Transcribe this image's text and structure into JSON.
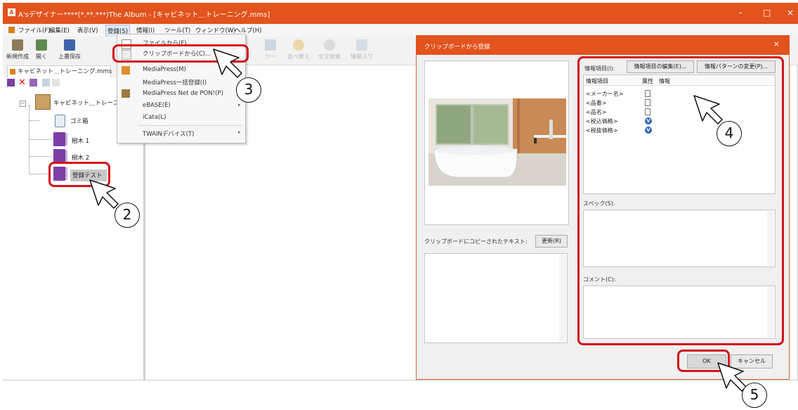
{
  "window": {
    "title": "A'sデザイナー****(*.**.***)The Album - [キャビネット＿トレーニング.mms]",
    "controls": [
      "-",
      "□",
      "×"
    ]
  },
  "menubar": {
    "items": [
      "ファイル(F)",
      "編集(E)",
      "表示(V)",
      "登録(S)",
      "情報(I)",
      "ツール(T)",
      "ウィンドウ(W)",
      "ヘルプ(H)"
    ]
  },
  "toolbar": {
    "new_label": "新規作成",
    "open_label": "開く",
    "overwrite_label": "上書保存",
    "faded": [
      "ツー",
      "並べ替え",
      "全文検索",
      "情報スワ"
    ]
  },
  "left_panel": {
    "tab_label": "キャビネット＿トレーニング.mms",
    "root_label": "キャビネット＿トレーニング",
    "items": [
      {
        "label": "ゴミ箱"
      },
      {
        "label": "樹木 1"
      },
      {
        "label": "樹木 2"
      },
      {
        "label": "登録テスト"
      }
    ]
  },
  "register_menu": {
    "items": [
      {
        "label": "ファイルから(F)",
        "icon": "file-icon"
      },
      {
        "label": "クリップボードから(C)...",
        "icon": "clipboard-icon"
      },
      {
        "label": "MediaPress(M)",
        "icon": "mediapress-icon"
      },
      {
        "label": "MediaPress一括登録(I)",
        "icon": ""
      },
      {
        "label": "MediaPress Net de PON!(P)",
        "icon": "mediapress-net-icon"
      },
      {
        "label": "eBASE(E)",
        "icon": ""
      },
      {
        "label": "iCata(L)",
        "icon": ""
      },
      {
        "label": "TWAINデバイス(T)",
        "icon": ""
      }
    ]
  },
  "dialog": {
    "title": "クリップボードから登録",
    "info_label": "情報項目(I):",
    "edit_items_button": "情報項目の編集(E)...",
    "change_pattern_button": "情報パターンの変更(P)...",
    "columns": [
      "情報項目",
      "属性",
      "情報"
    ],
    "rows": [
      {
        "name": "<メーカー名>",
        "attr": "text"
      },
      {
        "name": "<品番>",
        "attr": "text"
      },
      {
        "name": "<品名>",
        "attr": "text"
      },
      {
        "name": "<税込価格>",
        "attr": "value"
      },
      {
        "name": "<税抜価格>",
        "attr": "value"
      }
    ],
    "attr_value_glyph": "V",
    "spec_label": "スペック(S):",
    "comment_label": "コメント(C):",
    "clipboard_text_label": "クリップボードにコピーされたテキスト:",
    "refresh_button": "更新(R)",
    "ok_button": "OK",
    "cancel_button": "キャンセル"
  },
  "annotations": [
    "2",
    "3",
    "4",
    "5"
  ],
  "colors": {
    "title_bar": "#e2531d",
    "highlight_red": "#d3121b",
    "book_purple": "#7b3fa6"
  }
}
